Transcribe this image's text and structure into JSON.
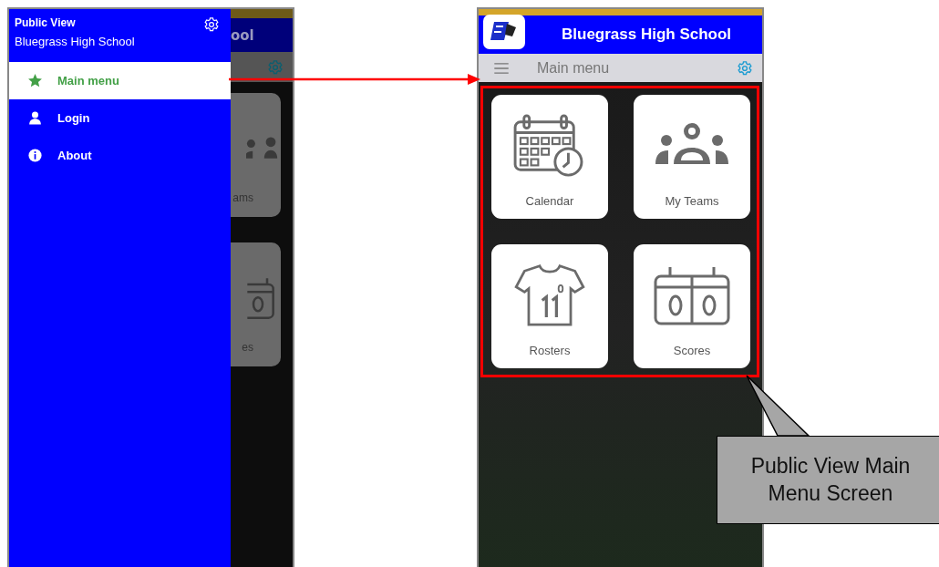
{
  "left_screen": {
    "background_title": "ool",
    "background_tiles": [
      {
        "label": "ams",
        "kind": "people"
      },
      {
        "label": "es",
        "kind": "scoreboard"
      }
    ],
    "drawer": {
      "title": "Public View",
      "subtitle": "Bluegrass High School",
      "items": [
        {
          "label": "Main menu",
          "kind": "star",
          "selected": true
        },
        {
          "label": "Login",
          "kind": "person",
          "selected": false
        },
        {
          "label": "About",
          "kind": "info",
          "selected": false
        }
      ]
    }
  },
  "right_screen": {
    "title": "Bluegrass High School",
    "toolbar_title": "Main menu",
    "tiles": [
      {
        "label": "Calendar",
        "kind": "calendar"
      },
      {
        "label": "My Teams",
        "kind": "people"
      },
      {
        "label": "Rosters",
        "kind": "jersey"
      },
      {
        "label": "Scores",
        "kind": "scoreboard"
      }
    ]
  },
  "callout": {
    "text": "Public View Main Menu Screen"
  }
}
